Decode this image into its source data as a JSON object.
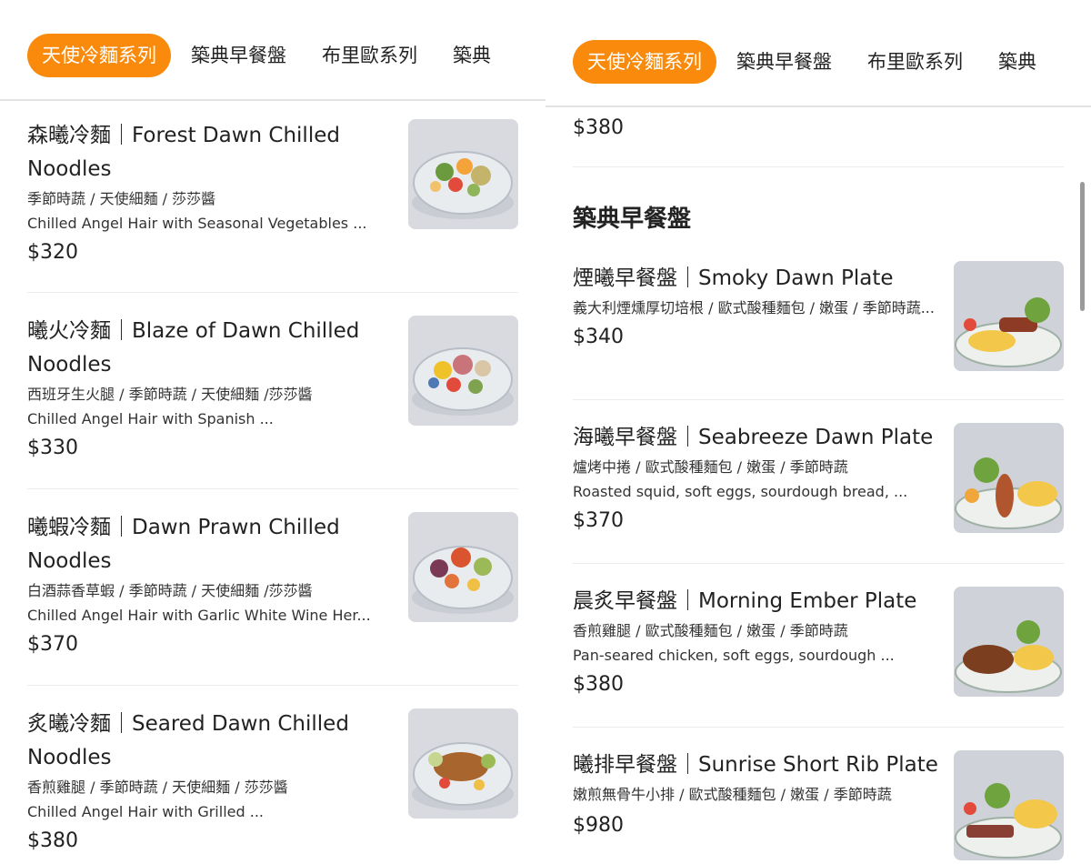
{
  "left": {
    "tabs": [
      {
        "label": "天使冷麵系列",
        "active": true
      },
      {
        "label": "築典早餐盤",
        "active": false
      },
      {
        "label": "布里歐系列",
        "active": false
      },
      {
        "label": "築典",
        "active": false
      }
    ],
    "items": [
      {
        "name": "森曦冷麵｜Forest Dawn Chilled Noodles",
        "desc_zh": "季節時蔬 / 天使細麵 / 莎莎醬",
        "desc_en": "Chilled Angel Hair with Seasonal Vegetables ...",
        "price": "$320"
      },
      {
        "name": "曦火冷麵｜Blaze of Dawn Chilled Noodles",
        "desc_zh": "西班牙生火腿 / 季節時蔬 / 天使細麵 /莎莎醬",
        "desc_en": "Chilled Angel Hair with Spanish ...",
        "price": "$330"
      },
      {
        "name": "曦蝦冷麵｜Dawn Prawn Chilled Noodles",
        "desc_zh": "白酒蒜香草蝦 / 季節時蔬 / 天使細麵 /莎莎醬",
        "desc_en": "Chilled Angel Hair with Garlic White Wine Her...",
        "price": "$370"
      },
      {
        "name": "炙曦冷麵｜Seared Dawn Chilled Noodles",
        "desc_zh": "香煎雞腿 / 季節時蔬 / 天使細麵 / 莎莎醬",
        "desc_en": "Chilled Angel Hair with Grilled ...",
        "price": "$380"
      }
    ]
  },
  "right": {
    "tabs": [
      {
        "label": "天使冷麵系列",
        "active": true
      },
      {
        "label": "築典早餐盤",
        "active": false
      },
      {
        "label": "布里歐系列",
        "active": false
      },
      {
        "label": "築典",
        "active": false
      }
    ],
    "prev_price": "$380",
    "section_title": "築典早餐盤",
    "items": [
      {
        "name": "煙曦早餐盤｜Smoky Dawn Plate",
        "desc_zh": "義大利煙燻厚切培根 / 歐式酸種麵包 / 嫩蛋 / 季節時蔬...",
        "desc_en": "",
        "price": "$340"
      },
      {
        "name": "海曦早餐盤｜Seabreeze Dawn Plate",
        "desc_zh": "爐烤中捲 / 歐式酸種麵包 / 嫩蛋 / 季節時蔬",
        "desc_en": "Roasted squid, soft eggs, sourdough bread, ...",
        "price": "$370"
      },
      {
        "name": "晨炙早餐盤｜Morning Ember Plate",
        "desc_zh": "香煎雞腿 / 歐式酸種麵包 / 嫩蛋 / 季節時蔬",
        "desc_en": "Pan-seared chicken, soft eggs, sourdough ...",
        "price": "$380"
      },
      {
        "name": "曦排早餐盤｜Sunrise Short Rib Plate",
        "desc_zh": "嫩煎無骨牛小排 / 歐式酸種麵包 / 嫩蛋 / 季節時蔬",
        "desc_en": "",
        "price": "$980"
      }
    ]
  },
  "colors": {
    "accent": "#f98a0b",
    "divider": "#ececec"
  }
}
